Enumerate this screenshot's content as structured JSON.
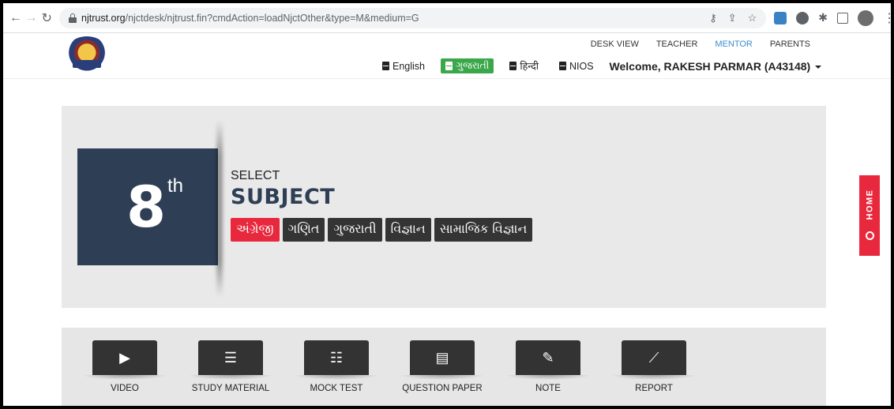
{
  "browser": {
    "url_host": "njtrust.org",
    "url_path": "/njctdesk/njtrust.fin?cmdAction=loadNjctOther&type=M&medium=G"
  },
  "header": {
    "top_links": [
      {
        "label": "DESK VIEW",
        "active": false
      },
      {
        "label": "TEACHER",
        "active": false
      },
      {
        "label": "MENTOR",
        "active": true
      },
      {
        "label": "PARENTS",
        "active": false
      }
    ],
    "languages": [
      {
        "label": "English",
        "active": false
      },
      {
        "label": "ગુજરાતી",
        "active": true
      },
      {
        "label": "हिन्दी",
        "active": false
      },
      {
        "label": "NIOS",
        "active": false
      }
    ],
    "welcome": "Welcome, RAKESH PARMAR (A43148)"
  },
  "hero": {
    "grade_number": "8",
    "grade_suffix": "th",
    "select_label": "SELECT",
    "subject_title": "SUBJECT",
    "subjects": [
      {
        "label": "અંગ્રેજી",
        "active": true
      },
      {
        "label": "ગણિત",
        "active": false
      },
      {
        "label": "ગુજરાતી",
        "active": false
      },
      {
        "label": "વિજ્ઞાન",
        "active": false
      },
      {
        "label": "સામાજિક વિજ્ઞાન",
        "active": false
      }
    ]
  },
  "tools": [
    {
      "label": "VIDEO",
      "icon": "video-icon",
      "glyph": "▶"
    },
    {
      "label": "STUDY MATERIAL",
      "icon": "books-icon",
      "glyph": "☰"
    },
    {
      "label": "MOCK TEST",
      "icon": "checklist-icon",
      "glyph": "☷"
    },
    {
      "label": "QUESTION PAPER",
      "icon": "question-paper-icon",
      "glyph": "▤"
    },
    {
      "label": "NOTE",
      "icon": "note-edit-icon",
      "glyph": "✎"
    },
    {
      "label": "REPORT",
      "icon": "chart-line-icon",
      "glyph": "⟋"
    }
  ],
  "home_tab": {
    "label": "HOME"
  },
  "colors": {
    "accent_red": "#e8293d",
    "active_green": "#3aa84a",
    "navy": "#2e3f55",
    "mentor_blue": "#3b8cd1"
  }
}
